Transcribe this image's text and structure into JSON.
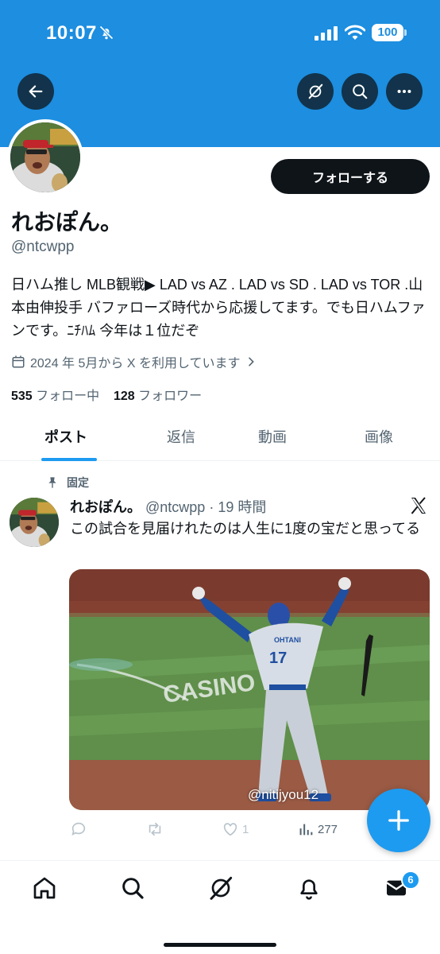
{
  "status_bar": {
    "time": "10:07",
    "battery": "100",
    "icons": [
      "bell-off-icon",
      "cellular-signal-icon",
      "wifi-icon",
      "battery-icon"
    ]
  },
  "header": {
    "banner_color": "#1d8ee0",
    "buttons": [
      "back-arrow-icon",
      "grok-icon",
      "search-icon",
      "more-icon"
    ]
  },
  "profile": {
    "follow_label": "フォローする",
    "display_name": "れおぽん。",
    "handle": "@ntcwpp",
    "bio": "日ハム推し MLB観戦▶ LAD vs AZ . LAD vs SD . LAD vs TOR .山本由伸投手 バファローズ時代から応援してます。でも日ハムファンです。ﾆﾁﾊﾑ 今年は１位だぞ",
    "joined": "2024 年 5月から X を利用しています",
    "following_count": "535",
    "following_label": "フォロー中",
    "followers_count": "128",
    "followers_label": "フォロワー"
  },
  "tabs": [
    {
      "label": "ポスト",
      "active": true
    },
    {
      "label": "返信",
      "active": false
    },
    {
      "label": "動画",
      "active": false
    },
    {
      "label": "画像",
      "active": false
    }
  ],
  "tweet": {
    "pinned_label": "固定",
    "name": "れおぽん。",
    "meta": "@ntcwpp · 19 時間",
    "text": "この試合を見届けれたのは人生に1度の宝だと思ってる",
    "watermark": "@nitijyou12",
    "jersey_name": "OHTANI",
    "jersey_number": "17",
    "likes": "1",
    "views": "277"
  },
  "bottom_nav": {
    "items": [
      "home-icon",
      "search-icon",
      "grok-icon",
      "notifications-icon",
      "messages-icon"
    ],
    "messages_badge": "6"
  },
  "colors": {
    "accent": "#1d9bf0",
    "text": "#0f1419",
    "secondary": "#536471"
  }
}
